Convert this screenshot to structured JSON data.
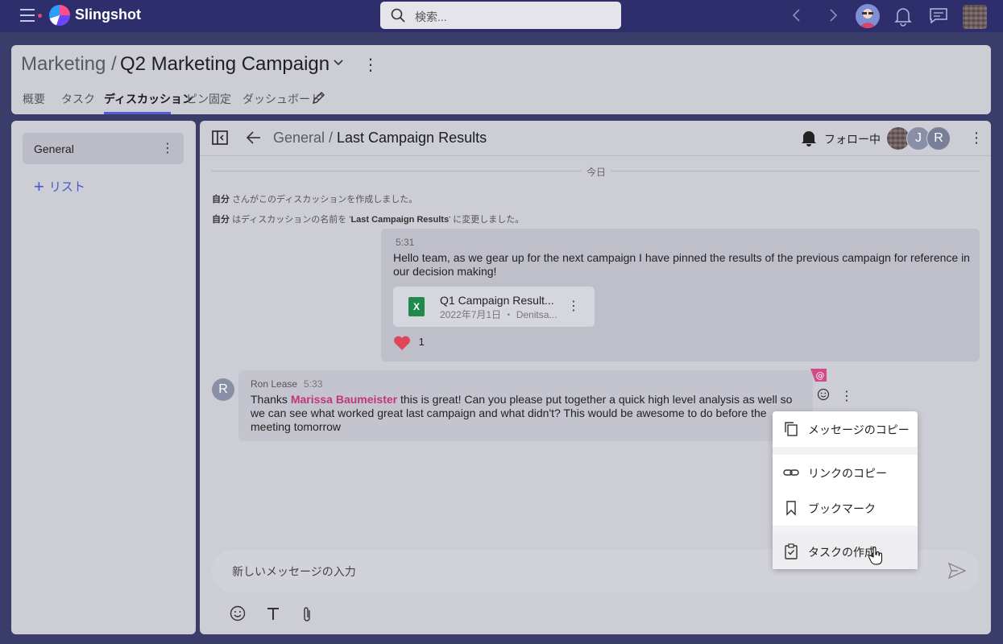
{
  "app": {
    "name": "Slingshot"
  },
  "search": {
    "placeholder": "検索..."
  },
  "header": {
    "breadcrumb_parent": "Marketing",
    "breadcrumb_sep": "/",
    "title": "Q2 Marketing Campaign",
    "tabs": [
      {
        "label": "概要"
      },
      {
        "label": "タスク"
      },
      {
        "label": "ディスカッション",
        "active": true
      },
      {
        "label": "ピン固定"
      },
      {
        "label": "ダッシュボード"
      }
    ]
  },
  "sidebar": {
    "items": [
      {
        "label": "General"
      }
    ],
    "add_label": "リスト"
  },
  "discussion": {
    "breadcrumb_parent": "General /",
    "title": "Last Campaign Results",
    "follow_label": "フォロー中",
    "participants": [
      "J",
      "R"
    ],
    "date_divider": "今日",
    "system_messages": [
      {
        "who": "自分",
        "text": "さんがこのディスカッションを作成しました。"
      },
      {
        "who": "自分",
        "text": "はディスカッションの名前を '",
        "bold": "Last Campaign Results",
        "tail": "' に変更しました。"
      }
    ],
    "own_message": {
      "time": "5:31",
      "text": "Hello team, as we gear up for the next campaign I have pinned the results of the previous campaign for reference in our decision making!",
      "attachment": {
        "name": "Q1 Campaign Result...",
        "meta": "2022年7月1日 ・ Denitsa...",
        "icon": "X"
      },
      "reaction_count": "1"
    },
    "reply": {
      "avatar": "R",
      "author": "Ron Lease",
      "time": "5:33",
      "text_before": "Thanks ",
      "mention": "Marissa Baumeister",
      "text_after": " this is great! Can you please put together a quick high level analysis as well so we can see what worked great last campaign and what didn't? This would be awesome to do before the meeting tomorrow"
    },
    "composer_placeholder": "新しいメッセージの入力"
  },
  "context_menu": {
    "items": [
      {
        "label": "メッセージのコピー",
        "icon": "copy-icon"
      },
      {
        "label": "リンクのコピー",
        "icon": "link-icon"
      },
      {
        "label": "ブックマーク",
        "icon": "bookmark-icon"
      },
      {
        "label": "タスクの作成",
        "icon": "task-icon",
        "hovered": true
      }
    ]
  },
  "colors": {
    "topbar": "#2d2e6b",
    "accent": "#4f5fd0",
    "mention": "#c2357a",
    "excel": "#1f8a4c"
  }
}
